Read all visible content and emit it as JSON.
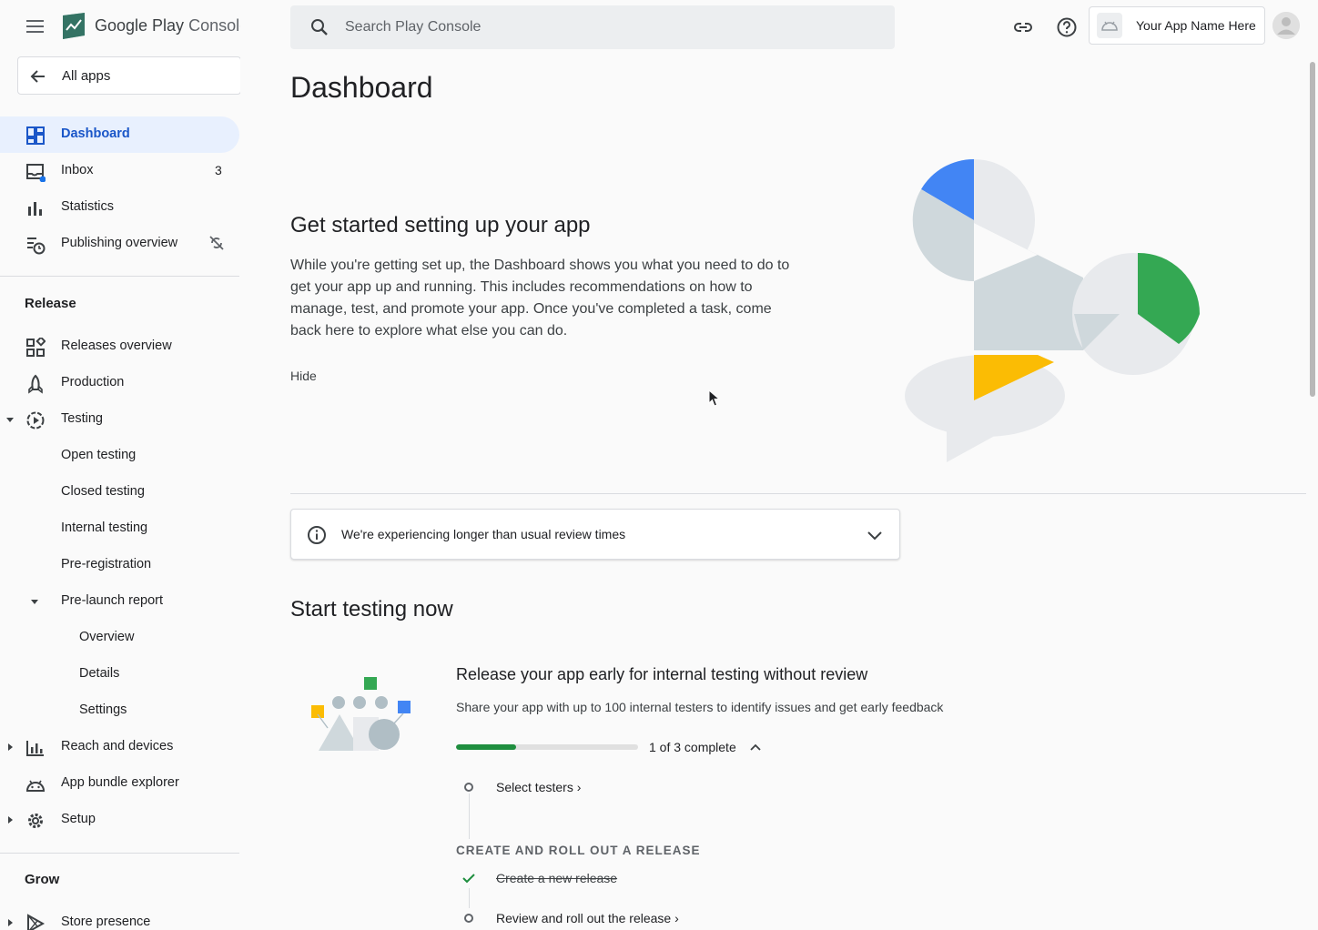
{
  "brand": {
    "name_a": "Google Play",
    "name_b": "Console"
  },
  "all_apps": "All apps",
  "nav_top": [
    {
      "label": "Dashboard"
    },
    {
      "label": "Inbox",
      "badge": "3"
    },
    {
      "label": "Statistics"
    },
    {
      "label": "Publishing overview"
    }
  ],
  "release": {
    "title": "Release",
    "items": {
      "releases_overview": "Releases overview",
      "production": "Production",
      "testing": "Testing",
      "open_testing": "Open testing",
      "closed_testing": "Closed testing",
      "internal_testing": "Internal testing",
      "pre_registration": "Pre-registration",
      "pre_launch_report": "Pre-launch report",
      "overview": "Overview",
      "details": "Details",
      "settings": "Settings",
      "reach_and_devices": "Reach and devices",
      "app_bundle_explorer": "App bundle explorer",
      "setup": "Setup"
    }
  },
  "grow": {
    "title": "Grow",
    "store_presence": "Store presence"
  },
  "search": {
    "placeholder": "Search Play Console"
  },
  "app_chip": {
    "label": "Your App Name Here"
  },
  "page_title": "Dashboard",
  "get_started": {
    "title": "Get started setting up your app",
    "body": "While you're getting set up, the Dashboard shows you what you need to do to get your app up and running. This includes recommendations on how to manage, test, and promote your app. Once you've completed a task, come back here to explore what else you can do.",
    "hide": "Hide"
  },
  "notice": {
    "text": "We're experiencing longer than usual review times"
  },
  "start_testing": {
    "title": "Start testing now",
    "task_title": "Release your app early for internal testing without review",
    "task_sub": "Share your app with up to 100 internal testers to identify issues and get early feedback",
    "progress_label": "1 of 3 complete",
    "progress_fraction": 0.33,
    "step_select_testers": "Select testers ›",
    "group_title": "CREATE AND ROLL OUT A RELEASE",
    "step_create_release": "Create a new release",
    "step_review_rollout": "Review and roll out the release ›"
  },
  "colors": {
    "accent_blue": "#1a56c8",
    "active_bg": "#e8f0fe",
    "progress_green": "#1e8e3e",
    "brand_blue": "#4285f4",
    "brand_green": "#34a853",
    "brand_yellow": "#fbbc04"
  }
}
